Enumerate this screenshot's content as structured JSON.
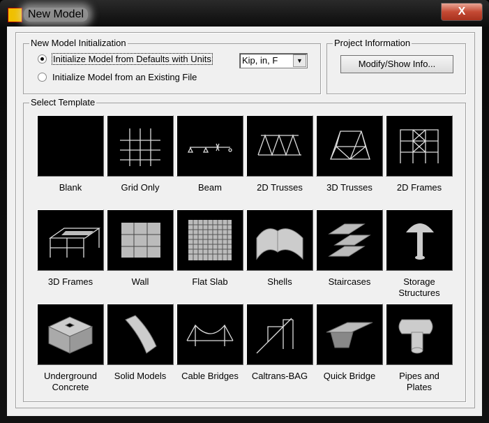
{
  "window": {
    "title": "New Model",
    "close_label": "X"
  },
  "init": {
    "legend": "New Model Initialization",
    "option_defaults": "Initialize Model from Defaults with Units",
    "option_file": "Initialize Model  from an Existing File",
    "selected": "defaults",
    "units_value": "Kip, in, F"
  },
  "project": {
    "legend": "Project Information",
    "button": "Modify/Show Info..."
  },
  "templates": {
    "legend": "Select Template",
    "items": [
      {
        "label": "Blank",
        "icon": "blank"
      },
      {
        "label": "Grid Only",
        "icon": "grid"
      },
      {
        "label": "Beam",
        "icon": "beam"
      },
      {
        "label": "2D Trusses",
        "icon": "truss2d"
      },
      {
        "label": "3D Trusses",
        "icon": "truss3d"
      },
      {
        "label": "2D Frames",
        "icon": "frame2d"
      },
      {
        "label": "3D Frames",
        "icon": "frame3d"
      },
      {
        "label": "Wall",
        "icon": "wall"
      },
      {
        "label": "Flat Slab",
        "icon": "slab"
      },
      {
        "label": "Shells",
        "icon": "shells"
      },
      {
        "label": "Staircases",
        "icon": "stairs"
      },
      {
        "label": "Storage Structures",
        "icon": "storage"
      },
      {
        "label": "Underground Concrete",
        "icon": "underground"
      },
      {
        "label": "Solid Models",
        "icon": "solid"
      },
      {
        "label": "Cable Bridges",
        "icon": "cable"
      },
      {
        "label": "Caltrans-BAG",
        "icon": "caltrans"
      },
      {
        "label": "Quick Bridge",
        "icon": "bridge"
      },
      {
        "label": "Pipes and Plates",
        "icon": "pipes"
      }
    ]
  }
}
